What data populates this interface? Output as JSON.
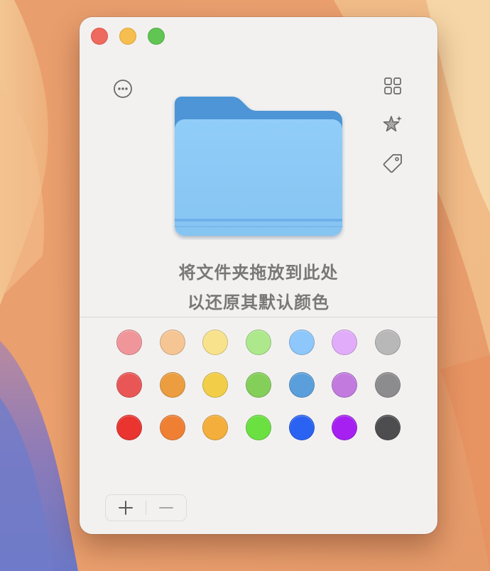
{
  "window": {
    "controls": [
      "close",
      "minimize",
      "maximize"
    ]
  },
  "toolbar": {
    "left_icons": [
      "more-circle-icon"
    ],
    "right_icons": [
      "grid-icon",
      "sparkle-star-icon",
      "tag-icon"
    ]
  },
  "drop_zone": {
    "line1": "将文件夹拖放到此处",
    "line2": "以还原其默认颜色",
    "folder_colors": {
      "back": "#4d95d6",
      "tab": "#4f97d8",
      "front": "#8ccbf6",
      "edge": "#6eb0e8"
    }
  },
  "palette": {
    "rows": [
      [
        "#f0969a",
        "#f6c594",
        "#f8e38c",
        "#ade98c",
        "#8dc7fb",
        "#e1adfa",
        "#b8b8b9"
      ],
      [
        "#e85756",
        "#eb9d3f",
        "#f2ce48",
        "#84cf5a",
        "#5a9fdb",
        "#c27adf",
        "#8c8c8f"
      ],
      [
        "#e9342f",
        "#ef7f33",
        "#f4ae3b",
        "#6ae041",
        "#2a62f2",
        "#a520f1",
        "#4d4d4f"
      ]
    ]
  },
  "bottom_bar": {
    "add_label": "+",
    "remove_label": "—"
  }
}
